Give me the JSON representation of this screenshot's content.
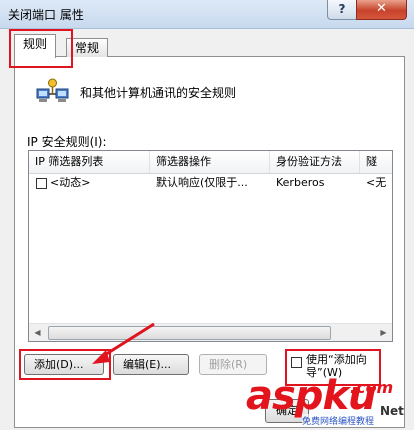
{
  "window": {
    "title": "关闭端口 属性",
    "help_glyph": "?",
    "close_glyph": "✕"
  },
  "tabs": [
    {
      "label": "规则"
    },
    {
      "label": "常规"
    }
  ],
  "panel": {
    "icon": "network-computers-icon",
    "description": "和其他计算机通讯的安全规则",
    "group_label": "IP 安全规则(I):"
  },
  "rules_table": {
    "columns": [
      "IP 筛选器列表",
      "筛选器操作",
      "身份验证方法",
      "隧"
    ],
    "rows": [
      {
        "checked": false,
        "filter_list": "<动态>",
        "filter_action": "默认响应(仅限于...",
        "auth_method": "Kerberos",
        "tunnel": "<无"
      }
    ]
  },
  "buttons": {
    "add": "添加(D)...",
    "edit": "编辑(E)...",
    "delete": "删除(R)",
    "use_wizard": "使用“添加向导”(W)",
    "ok": "确定"
  },
  "watermark": {
    "brand": "asp",
    "brand_tail": "ku",
    "suffix": ".com",
    "subtitle": "免费网络编程教程",
    "net": "Net"
  },
  "colors": {
    "highlight_red": "#e0141e",
    "titlebar": "#c8d9ee",
    "dialog_bg": "#f0f0f0"
  }
}
